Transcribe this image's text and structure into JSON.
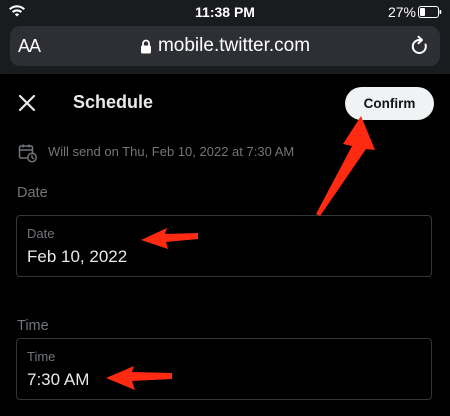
{
  "status_bar": {
    "time": "11:38 PM",
    "battery": "27%"
  },
  "browser": {
    "text_size_button": "AA",
    "url": "mobile.twitter.com"
  },
  "modal": {
    "title": "Schedule",
    "confirm_label": "Confirm",
    "will_send": "Will send on Thu, Feb 10, 2022 at 7:30 AM"
  },
  "date_section": {
    "heading": "Date",
    "field_label": "Date",
    "value": "Feb 10, 2022"
  },
  "time_section": {
    "heading": "Time",
    "field_label": "Time",
    "value": "7:30 AM"
  },
  "colors": {
    "background": "#000000",
    "annotation_arrow": "#ff2a12",
    "confirm_button_bg": "#eff3f4"
  }
}
